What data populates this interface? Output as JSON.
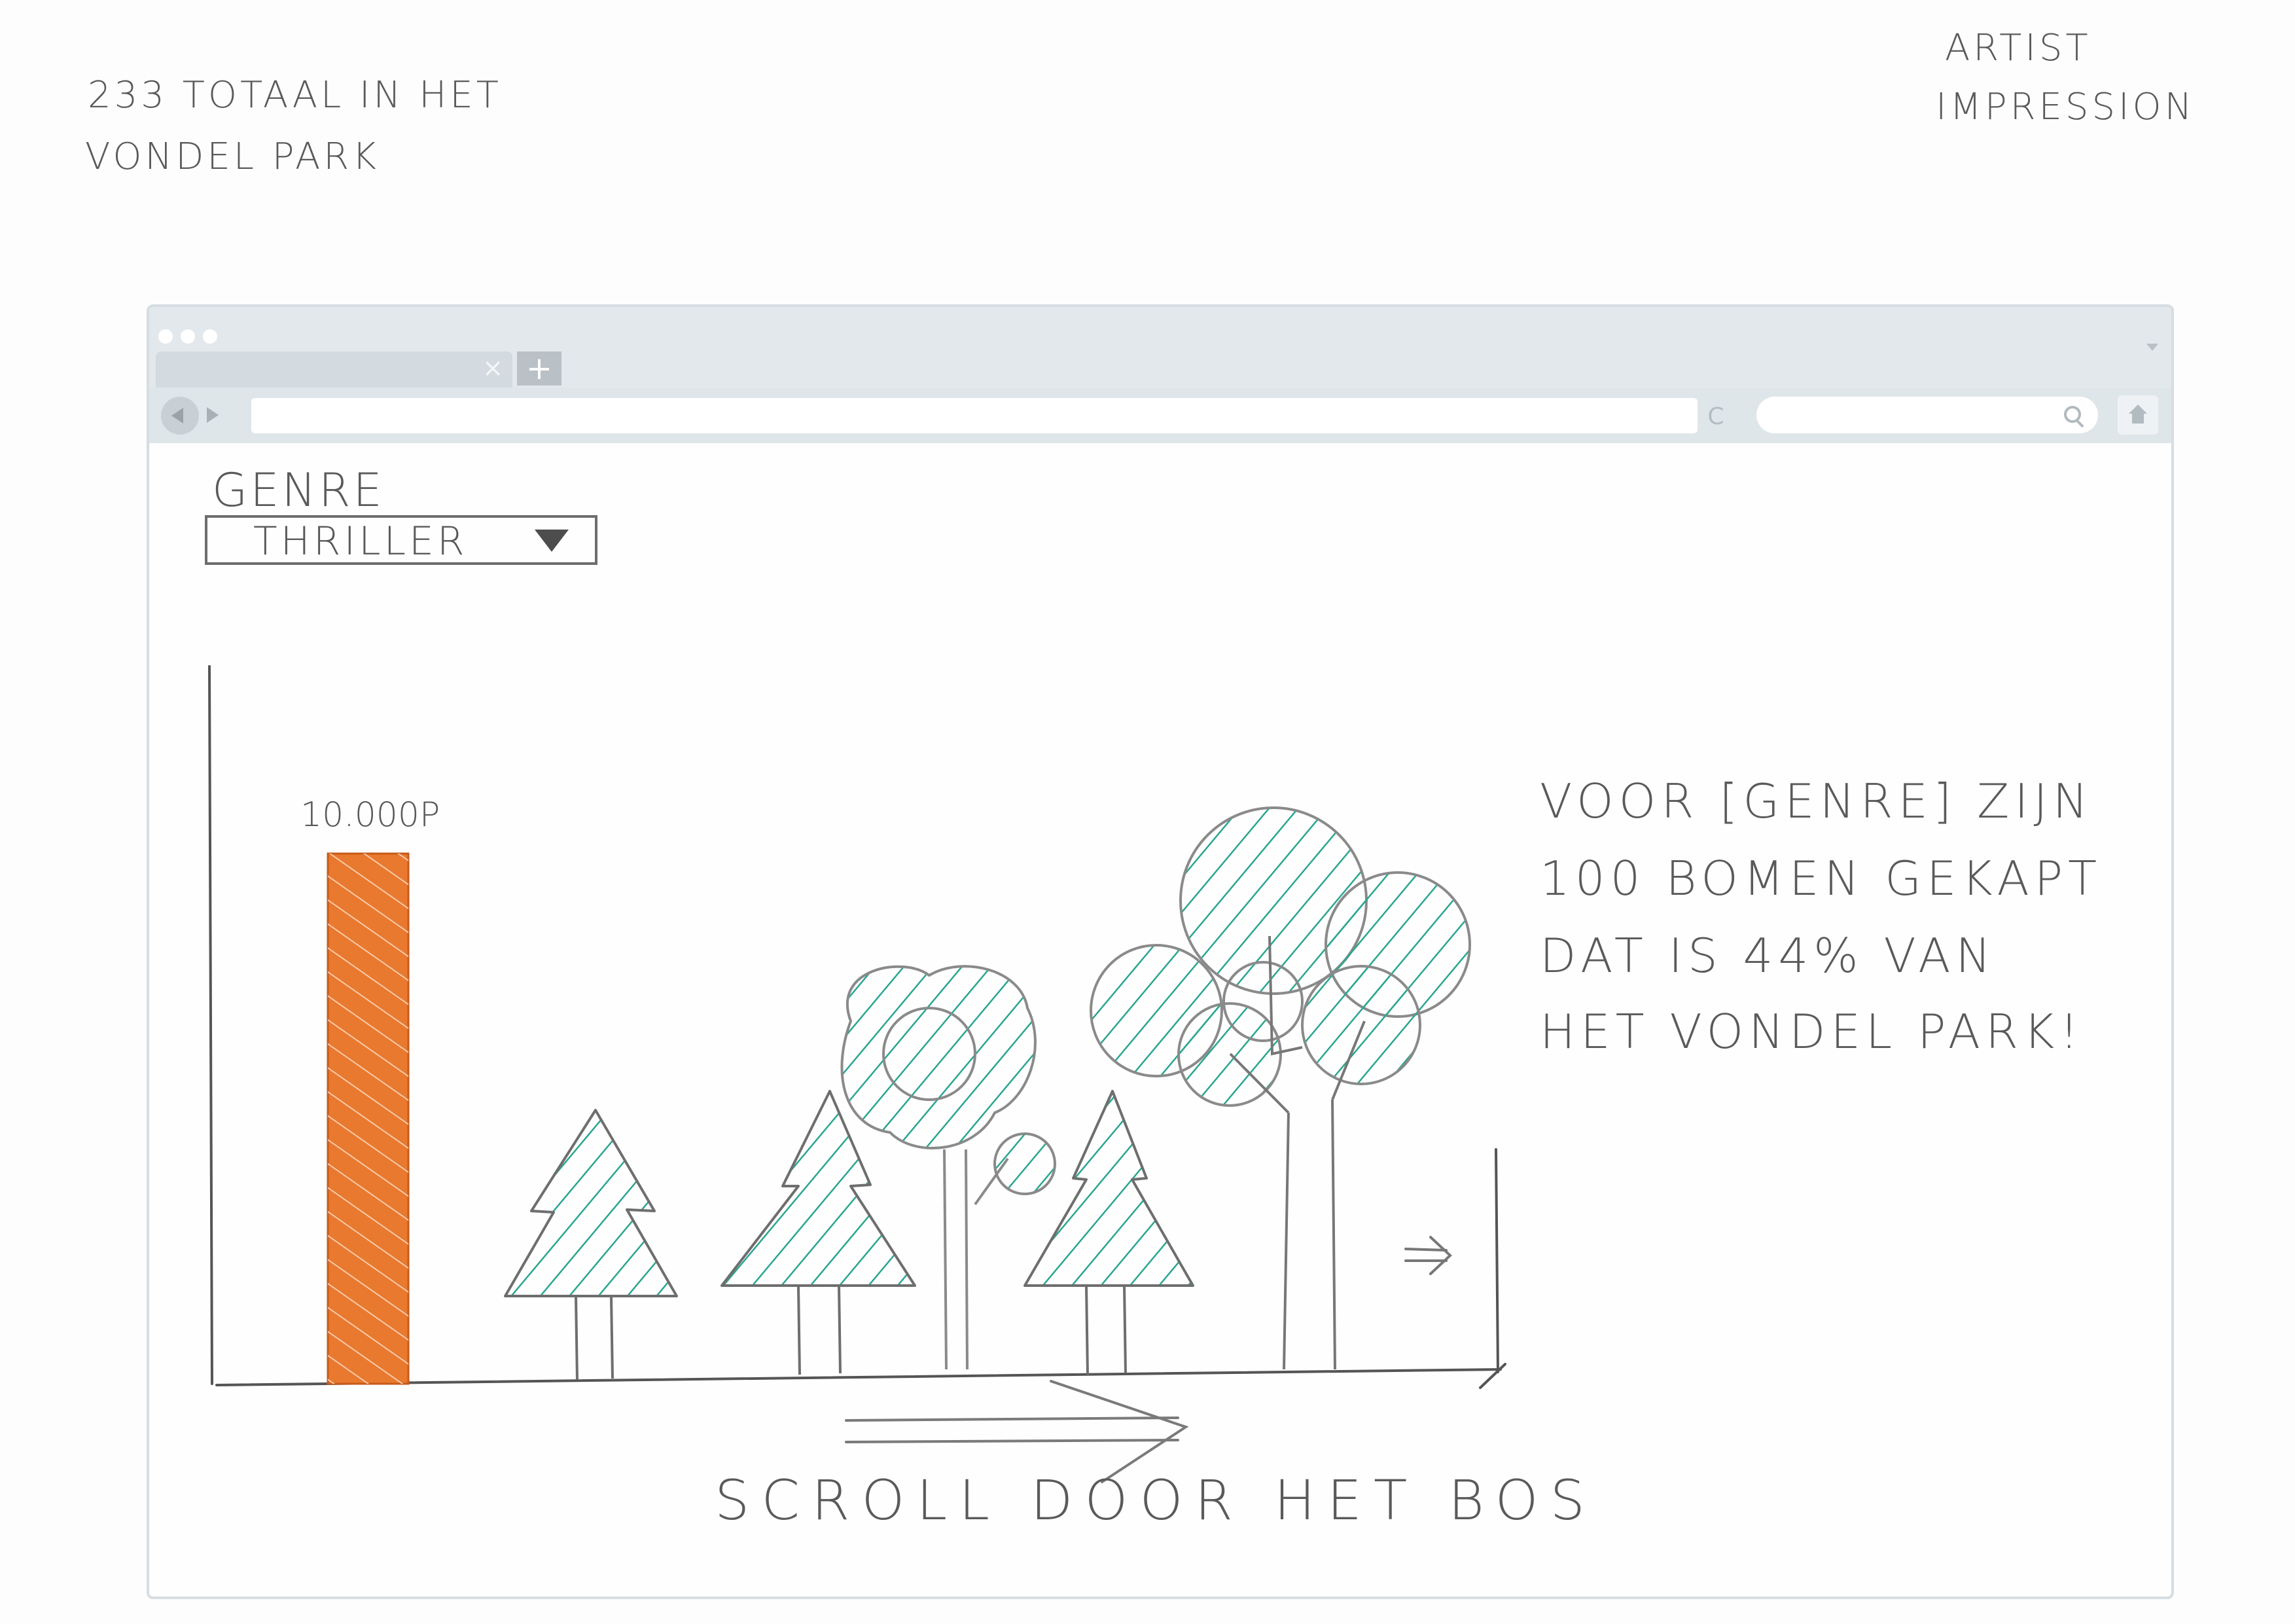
{
  "notes": {
    "top_left": [
      "233 TOTAAL IN HET",
      "VONDEL PARK"
    ],
    "top_right": [
      "ARTIST",
      "IMPRESSION"
    ]
  },
  "browser": {
    "tab_close": "×",
    "new_tab": "+",
    "reload": "C",
    "address": "",
    "search": ""
  },
  "page": {
    "genre": {
      "label": "GENRE",
      "selected": "THRILLER"
    },
    "statement": [
      "VOOR [GENRE] ZIJN",
      "100 BOMEN GEKAPT",
      "DAT IS 44% VAN",
      "HET VONDEL PARK!"
    ],
    "scroll_hint": "SCROLL DOOR HET BOS",
    "next_arrow": "⇒"
  },
  "colors": {
    "bar": "#e8792e",
    "tree_hatch": "#2aa68f",
    "pencil": "#6b6b6b"
  },
  "chart_data": {
    "type": "bar",
    "title": "",
    "xlabel": "",
    "ylabel": "",
    "categories": [
      ""
    ],
    "values": [
      10000
    ],
    "value_labels": [
      "10.000P"
    ]
  }
}
